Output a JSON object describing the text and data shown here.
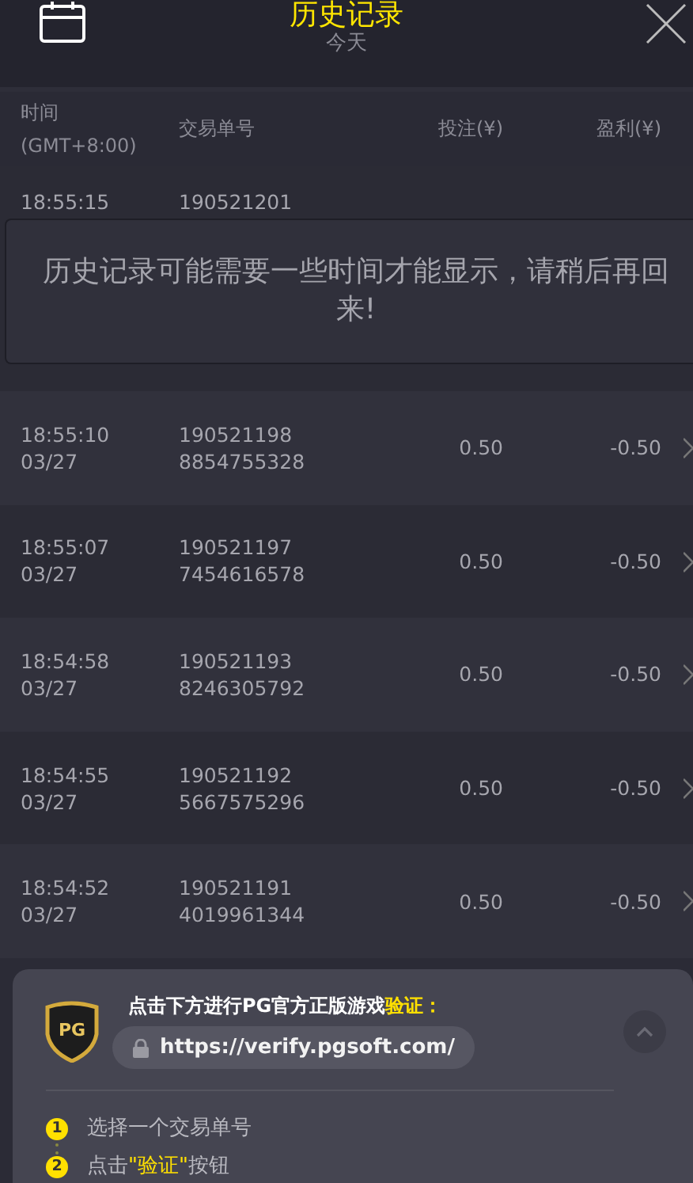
{
  "header": {
    "title": "历史记录",
    "subtitle": "今天"
  },
  "columns": [
    {
      "lines": [
        "时间",
        "(GMT+8:00)"
      ]
    },
    {
      "lines": [
        "交易单号"
      ]
    },
    {
      "lines": [
        "投注(¥)"
      ]
    },
    {
      "lines": [
        "盈利(¥)"
      ]
    }
  ],
  "partial_row": {
    "time": "18:55:15",
    "order": "190521201"
  },
  "notice": "历史记录可能需要一些时间才能显示，请稍后再回来!",
  "rows": [
    {
      "time": "18:55:10",
      "date": "03/27",
      "order": [
        "190521198",
        "8854755328"
      ],
      "bet": "0.50",
      "profit": "-0.50"
    },
    {
      "time": "18:55:07",
      "date": "03/27",
      "order": [
        "190521197",
        "7454616578"
      ],
      "bet": "0.50",
      "profit": "-0.50"
    },
    {
      "time": "18:54:58",
      "date": "03/27",
      "order": [
        "190521193",
        "8246305792"
      ],
      "bet": "0.50",
      "profit": "-0.50"
    },
    {
      "time": "18:54:55",
      "date": "03/27",
      "order": [
        "190521192",
        "5667575296"
      ],
      "bet": "0.50",
      "profit": "-0.50"
    },
    {
      "time": "18:54:52",
      "date": "03/27",
      "order": [
        "190521191",
        "4019961344"
      ],
      "bet": "0.50",
      "profit": "-0.50"
    }
  ],
  "verify": {
    "logo": "PG",
    "heading": [
      {
        "text": "点击下方进行PG官方正版游戏",
        "highlight": false
      },
      {
        "text": "验证：",
        "highlight": true
      }
    ],
    "url": "https://verify.pgsoft.com/",
    "steps": [
      {
        "number": "1",
        "parts": [
          {
            "text": "选择一个交易单号",
            "highlight": false
          }
        ]
      },
      {
        "number": "2",
        "parts": [
          {
            "text": "点击",
            "highlight": false
          },
          {
            "text": "\"验证\"",
            "highlight": true
          },
          {
            "text": "按钮",
            "highlight": false
          }
        ]
      }
    ]
  }
}
